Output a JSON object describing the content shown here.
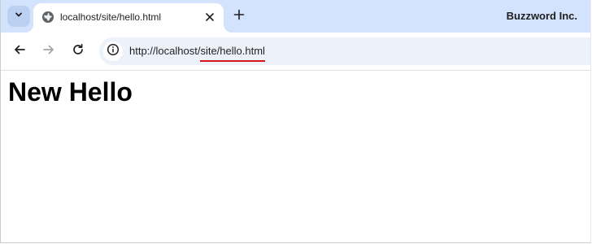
{
  "browser": {
    "tab": {
      "title": "localhost/site/hello.html",
      "favicon_icon": "globe-icon",
      "close_icon": "close-icon"
    },
    "tab_search_icon": "chevron-down-icon",
    "new_tab_icon": "plus-icon",
    "profile_name": "Buzzword Inc.",
    "toolbar": {
      "back_icon": "arrow-left-icon",
      "forward_icon": "arrow-right-icon",
      "reload_icon": "reload-icon",
      "site_info_icon": "info-icon"
    },
    "address_bar": {
      "url_prefix": "http://localhost/",
      "url_highlight": "site/hello.html",
      "highlight_color": "#d3141b"
    }
  },
  "page": {
    "heading": "New Hello"
  },
  "colors": {
    "tabstrip": "#d3e3fd",
    "omnibox": "#edf2fa"
  }
}
